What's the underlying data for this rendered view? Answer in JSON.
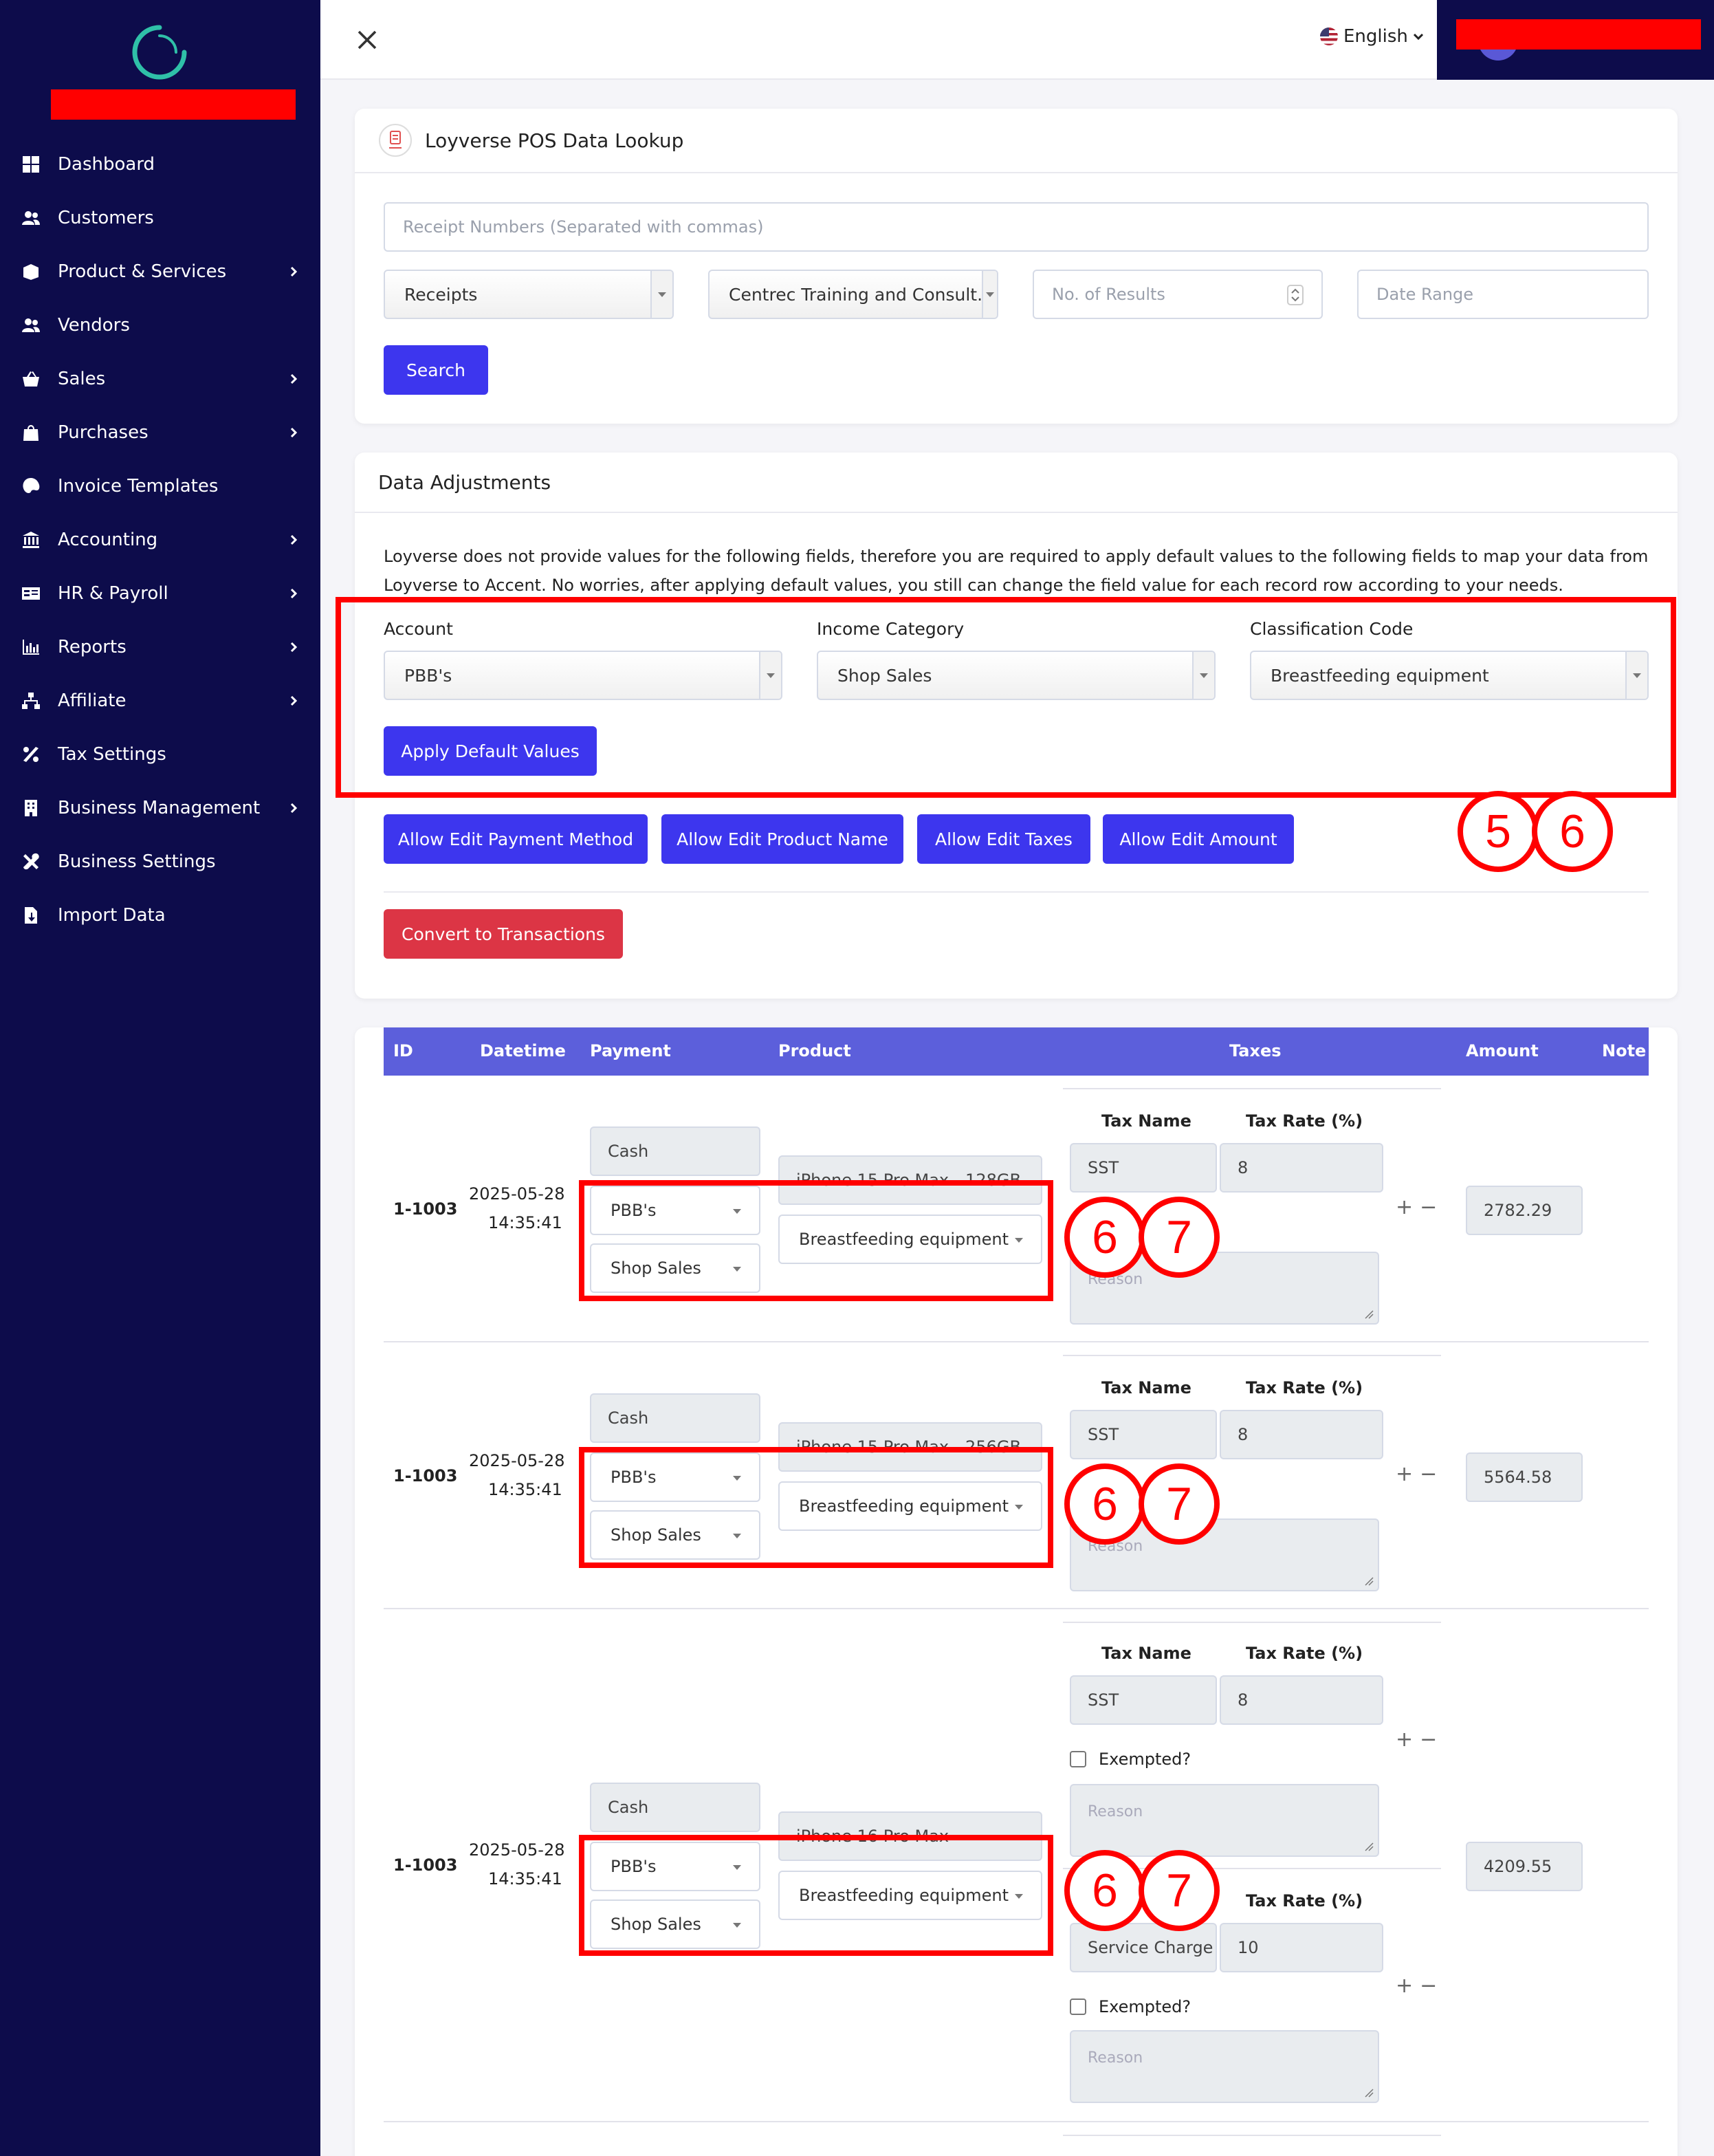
{
  "sidebar": {
    "items": [
      {
        "label": "Dashboard",
        "icon": "dashboard-icon",
        "has_submenu": false
      },
      {
        "label": "Customers",
        "icon": "users-icon",
        "has_submenu": false
      },
      {
        "label": "Product & Services",
        "icon": "box-icon",
        "has_submenu": true
      },
      {
        "label": "Vendors",
        "icon": "users-icon",
        "has_submenu": false
      },
      {
        "label": "Sales",
        "icon": "basket-icon",
        "has_submenu": true
      },
      {
        "label": "Purchases",
        "icon": "bag-icon",
        "has_submenu": true
      },
      {
        "label": "Invoice Templates",
        "icon": "palette-icon",
        "has_submenu": false
      },
      {
        "label": "Accounting",
        "icon": "bank-icon",
        "has_submenu": true
      },
      {
        "label": "HR & Payroll",
        "icon": "id-card-icon",
        "has_submenu": true
      },
      {
        "label": "Reports",
        "icon": "bar-chart-icon",
        "has_submenu": true
      },
      {
        "label": "Affiliate",
        "icon": "network-icon",
        "has_submenu": true
      },
      {
        "label": "Tax Settings",
        "icon": "percent-icon",
        "has_submenu": false
      },
      {
        "label": "Business Management",
        "icon": "building-icon",
        "has_submenu": true
      },
      {
        "label": "Business Settings",
        "icon": "tools-icon",
        "has_submenu": false
      },
      {
        "label": "Import Data",
        "icon": "file-import-icon",
        "has_submenu": false
      }
    ]
  },
  "topbar": {
    "language": "English"
  },
  "lookup": {
    "title": "Loyverse POS Data Lookup",
    "receipt_placeholder": "Receipt Numbers (Separated with commas)",
    "type_select": "Receipts",
    "store_select": "Centrec Training and Consult...",
    "results_placeholder": "No. of Results",
    "date_placeholder": "Date Range",
    "search_label": "Search"
  },
  "adjust": {
    "title": "Data Adjustments",
    "description_line1": "Loyverse does not provide values for the following fields, therefore you are required to apply default values to the following fields to map your data from",
    "description_line2": "Loyverse to Accent. No worries, after applying default values, you still can change the field value for each record row according to your needs.",
    "account_label": "Account",
    "account_value": "PBB's",
    "income_label": "Income Category",
    "income_value": "Shop Sales",
    "classification_label": "Classification Code",
    "classification_value": "Breastfeeding equipment",
    "apply_label": "Apply Default Values",
    "edit_payment": "Allow Edit Payment Method",
    "edit_product": "Allow Edit Product Name",
    "edit_taxes": "Allow Edit Taxes",
    "edit_amount": "Allow Edit Amount",
    "convert_label": "Convert to Transactions"
  },
  "annotations": {
    "a5": "5",
    "a6": "6",
    "a7": "7"
  },
  "table": {
    "headers": [
      "ID",
      "Datetime",
      "Payment",
      "Product",
      "Taxes",
      "Amount",
      "Note"
    ],
    "tax_name_header": "Tax Name",
    "tax_rate_header": "Tax Rate (%)",
    "exempted_label": "Exempted?",
    "reason_placeholder": "Reason",
    "rows": [
      {
        "id": "1-1003",
        "date": "2025-05-28",
        "time": "14:35:41",
        "payment": "Cash",
        "account": "PBB's",
        "income": "Shop Sales",
        "product": "iPhone 15 Pro Max - 128GB",
        "classification": "Breastfeeding equipment",
        "tax_name": "SST",
        "tax_rate": "8",
        "amount": "2782.29"
      },
      {
        "id": "1-1003",
        "date": "2025-05-28",
        "time": "14:35:41",
        "payment": "Cash",
        "account": "PBB's",
        "income": "Shop Sales",
        "product": "iPhone 15 Pro Max - 256GB",
        "classification": "Breastfeeding equipment",
        "tax_name": "SST",
        "tax_rate": "8",
        "amount": "5564.58"
      },
      {
        "id": "1-1003",
        "date": "2025-05-28",
        "time": "14:35:41",
        "payment": "Cash",
        "account": "PBB's",
        "income": "Shop Sales",
        "product": "iPhone 16 Pro Max",
        "classification": "Breastfeeding equipment",
        "tax_name": "SST",
        "tax_rate": "8",
        "tax_name_2": "Service Charge",
        "tax_rate_2": "10",
        "amount": "4209.55"
      }
    ]
  },
  "colors": {
    "sidebar": "#0d0c4b",
    "primary": "#3d36ee",
    "danger": "#dc3545",
    "table_header": "#5c5fdb",
    "annotation": "#ff0000"
  }
}
